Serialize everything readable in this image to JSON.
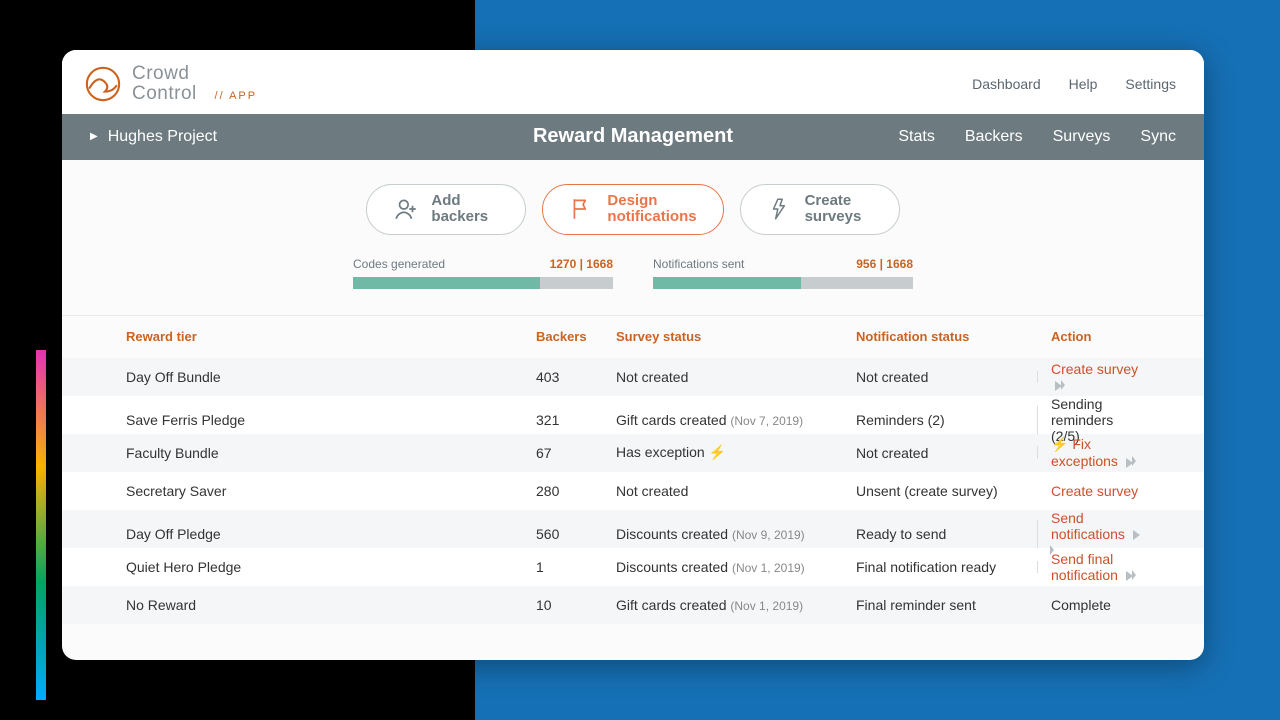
{
  "brand": {
    "line1": "Crowd",
    "line2": "Control",
    "suffix": "//  APP"
  },
  "topnav": {
    "dashboard": "Dashboard",
    "help": "Help",
    "settings": "Settings"
  },
  "subbar": {
    "project": "Hughes Project",
    "title": "Reward Management",
    "nav": {
      "stats": "Stats",
      "backers": "Backers",
      "surveys": "Surveys",
      "sync": "Sync"
    }
  },
  "pills": {
    "add": {
      "l1": "Add",
      "l2": "backers"
    },
    "design": {
      "l1": "Design",
      "l2": "notifications"
    },
    "create": {
      "l1": "Create",
      "l2": "surveys"
    }
  },
  "progress": {
    "codes": {
      "label": "Codes generated",
      "count": "1270 | 1668",
      "pct": 72
    },
    "notifs": {
      "label": "Notifications sent",
      "count": "956 | 1668",
      "pct": 57
    }
  },
  "columns": {
    "tier": "Reward tier",
    "backers": "Backers",
    "survey": "Survey status",
    "notif": "Notification status",
    "action": "Action"
  },
  "rows": [
    {
      "tier": "Day Off Bundle",
      "backers": "403",
      "survey": "Not created",
      "survey_date": "",
      "notif": "Not created",
      "action": "Create survey",
      "action_link": true,
      "action_icon": "tri",
      "alt": true
    },
    {
      "tier": "Save Ferris Pledge",
      "backers": "321",
      "survey": "Gift cards created",
      "survey_date": "(Nov 7, 2019)",
      "notif": "Reminders (2)",
      "action": "Sending reminders (2/5)",
      "action_link": false,
      "action_icon": "",
      "alt": false
    },
    {
      "tier": "Faculty Bundle",
      "backers": "67",
      "survey": "Has exception",
      "survey_date": "",
      "survey_bolt": true,
      "notif": "Not created",
      "action": "Fix exceptions",
      "action_prefix_bolt": true,
      "action_link": true,
      "action_icon": "tri",
      "alt": true
    },
    {
      "tier": "Secretary Saver",
      "backers": "280",
      "survey": "Not created",
      "survey_date": "",
      "notif": "Unsent (create survey)",
      "action": "Create survey",
      "action_link": true,
      "action_icon": "",
      "alt": false
    },
    {
      "tier": "Day Off Pledge",
      "backers": "560",
      "survey": "Discounts created",
      "survey_date": "(Nov 9, 2019)",
      "notif": "Ready to send",
      "action": "Send notifications",
      "action_link": true,
      "action_icon": "tri",
      "alt": true
    },
    {
      "tier": "Quiet Hero Pledge",
      "backers": "1",
      "survey": "Discounts created",
      "survey_date": "(Nov 1, 2019)",
      "notif": "Final notification ready",
      "action": "Send final notification",
      "action_link": true,
      "action_icon": "tri",
      "alt": false
    },
    {
      "tier": "No Reward",
      "backers": "10",
      "survey": "Gift cards created",
      "survey_date": "(Nov 1, 2019)",
      "notif": "Final reminder sent",
      "action": "Complete",
      "action_link": false,
      "action_icon": "",
      "alt": true
    }
  ]
}
